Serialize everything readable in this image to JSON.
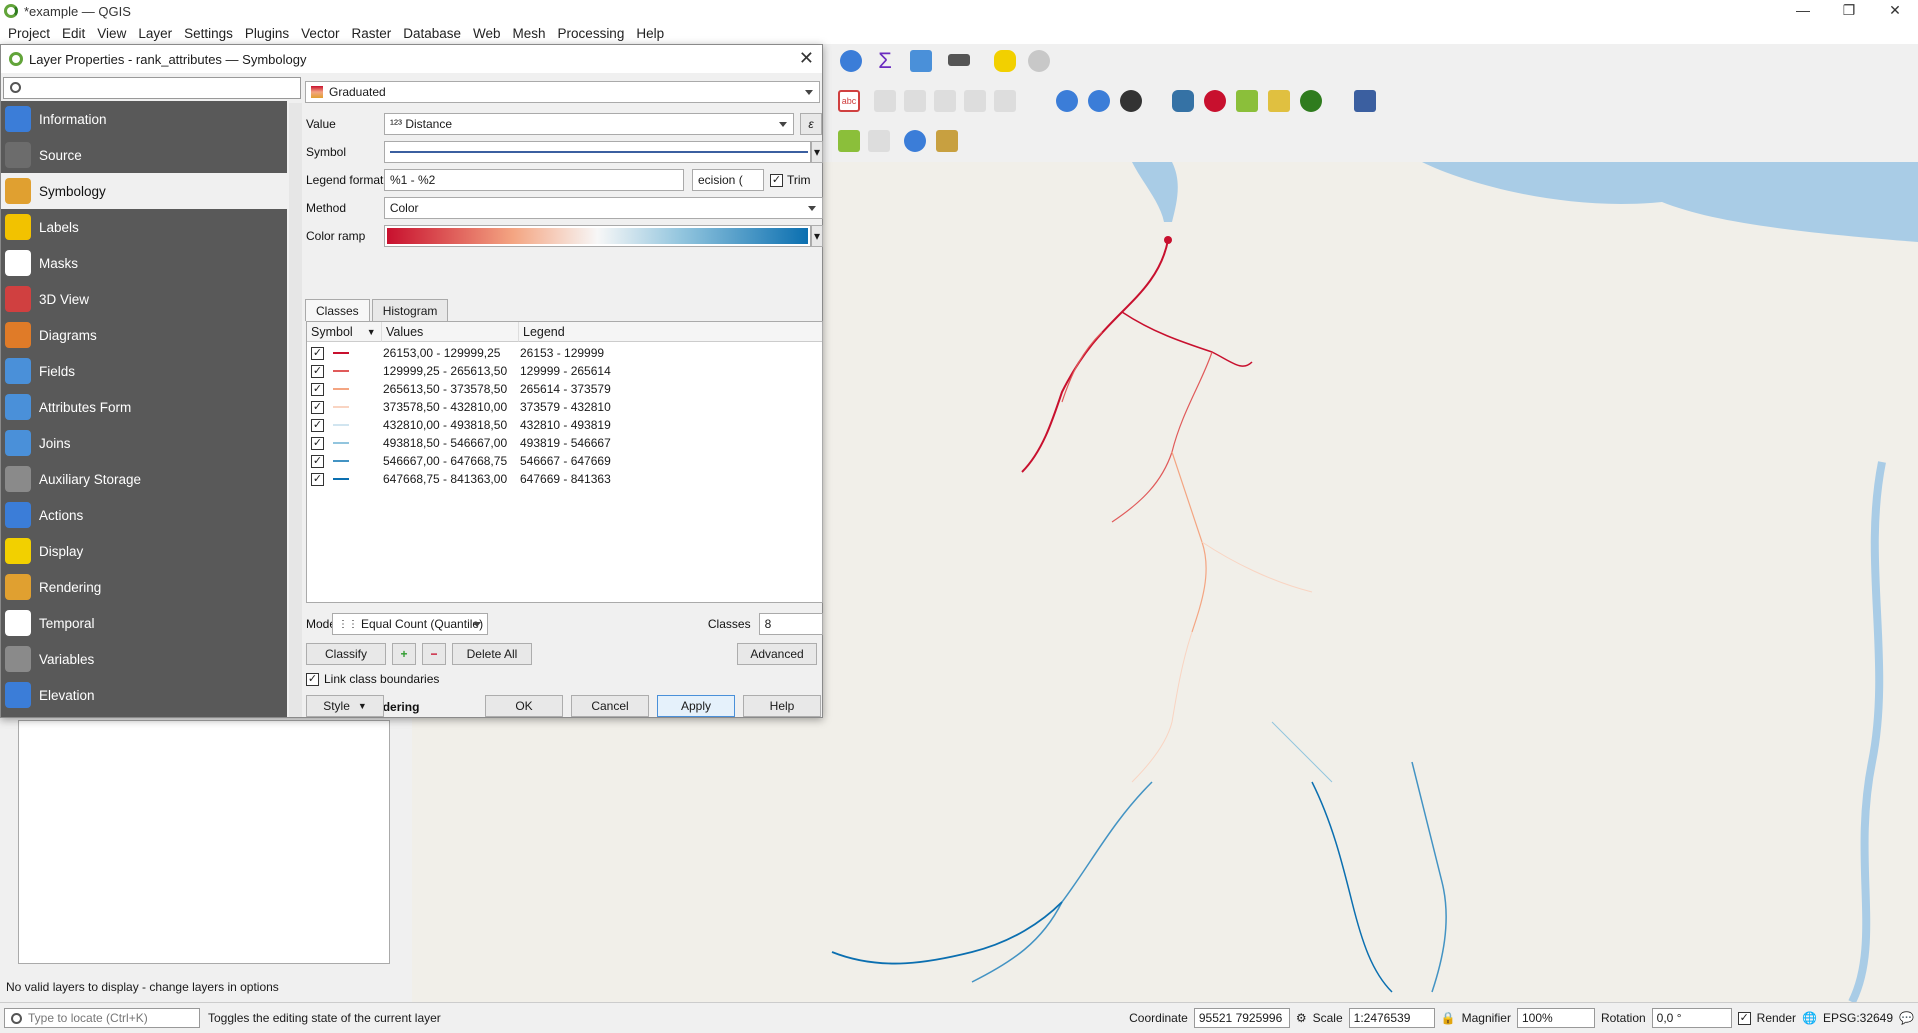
{
  "app": {
    "title": "*example — QGIS",
    "menu": [
      "Project",
      "Edit",
      "View",
      "Layer",
      "Settings",
      "Plugins",
      "Vector",
      "Raster",
      "Database",
      "Web",
      "Mesh",
      "Processing",
      "Help"
    ]
  },
  "dialog": {
    "title": "Layer Properties - rank_attributes — Symbology",
    "sidebar": [
      {
        "label": "Information",
        "icon": "information-icon",
        "color": "#3b7dd8"
      },
      {
        "label": "Source",
        "icon": "source-icon",
        "color": "#6c6c6c"
      },
      {
        "label": "Symbology",
        "icon": "symbology-icon",
        "color": "#e0a030"
      },
      {
        "label": "Labels",
        "icon": "labels-icon",
        "color": "#f2c200"
      },
      {
        "label": "Masks",
        "icon": "masks-icon",
        "color": "#ffffff"
      },
      {
        "label": "3D View",
        "icon": "3d-view-icon",
        "color": "#d04040"
      },
      {
        "label": "Diagrams",
        "icon": "diagrams-icon",
        "color": "#e07b28"
      },
      {
        "label": "Fields",
        "icon": "fields-icon",
        "color": "#4a90d9"
      },
      {
        "label": "Attributes Form",
        "icon": "attributes-form-icon",
        "color": "#4a90d9"
      },
      {
        "label": "Joins",
        "icon": "joins-icon",
        "color": "#4a90d9"
      },
      {
        "label": "Auxiliary Storage",
        "icon": "auxiliary-storage-icon",
        "color": "#8a8a8a"
      },
      {
        "label": "Actions",
        "icon": "actions-icon",
        "color": "#3b7dd8"
      },
      {
        "label": "Display",
        "icon": "display-icon",
        "color": "#f2d000"
      },
      {
        "label": "Rendering",
        "icon": "rendering-icon",
        "color": "#e0a030"
      },
      {
        "label": "Temporal",
        "icon": "temporal-icon",
        "color": "#ffffff"
      },
      {
        "label": "Variables",
        "icon": "variables-icon",
        "color": "#8a8a8a"
      },
      {
        "label": "Elevation",
        "icon": "elevation-icon",
        "color": "#3b7dd8"
      }
    ],
    "renderer": "Graduated",
    "value_label": "Value",
    "value_field": "¹²³ Distance",
    "symbol_label": "Symbol",
    "legend_format_label": "Legend format",
    "legend_format": "%1 - %2",
    "precision": "ecision (",
    "trim_label": "Trim",
    "method_label": "Method",
    "method": "Color",
    "color_ramp_label": "Color ramp",
    "tabs": [
      "Classes",
      "Histogram"
    ],
    "columns": [
      "Symbol",
      "Values",
      "Legend"
    ],
    "classes": [
      {
        "values": "26153,00 - 129999,25",
        "legend": "26153 - 129999",
        "color": "#c8102e"
      },
      {
        "values": "129999,25 - 265613,50",
        "legend": "129999 - 265614",
        "color": "#e05a5a"
      },
      {
        "values": "265613,50 - 373578,50",
        "legend": "265614 - 373579",
        "color": "#f4a582"
      },
      {
        "values": "373578,50 - 432810,00",
        "legend": "373579 - 432810",
        "color": "#f9d4c2"
      },
      {
        "values": "432810,00 - 493818,50",
        "legend": "432810 - 493819",
        "color": "#d1e5f0"
      },
      {
        "values": "493818,50 - 546667,00",
        "legend": "493819 - 546667",
        "color": "#92c5de"
      },
      {
        "values": "546667,00 - 647668,75",
        "legend": "546667 - 647669",
        "color": "#4393c3"
      },
      {
        "values": "647668,75 - 841363,00",
        "legend": "647669 - 841363",
        "color": "#0b6fb0"
      }
    ],
    "mode_label": "Mode",
    "mode": "Equal Count (Quantile)",
    "classes_label": "Classes",
    "classes_count": "8",
    "classify": "Classify",
    "delete_all": "Delete All",
    "advanced": "Advanced",
    "link_boundaries": "Link class boundaries",
    "layer_rendering": "Layer Rendering",
    "style": "Style",
    "ok": "OK",
    "cancel": "Cancel",
    "apply": "Apply",
    "help": "Help"
  },
  "layers_panel": {
    "message": "No valid layers to display - change layers in options"
  },
  "statusbar": {
    "locate_placeholder": "Type to locate (Ctrl+K)",
    "message": "Toggles the editing state of the current layer",
    "coordinate_label": "Coordinate",
    "coordinate": "95521  7925996",
    "scale_label": "Scale",
    "scale": "1:2476539",
    "magnifier_label": "Magnifier",
    "magnifier": "100%",
    "rotation_label": "Rotation",
    "rotation": "0,0 °",
    "render_label": "Render",
    "crs": "EPSG:32649"
  }
}
